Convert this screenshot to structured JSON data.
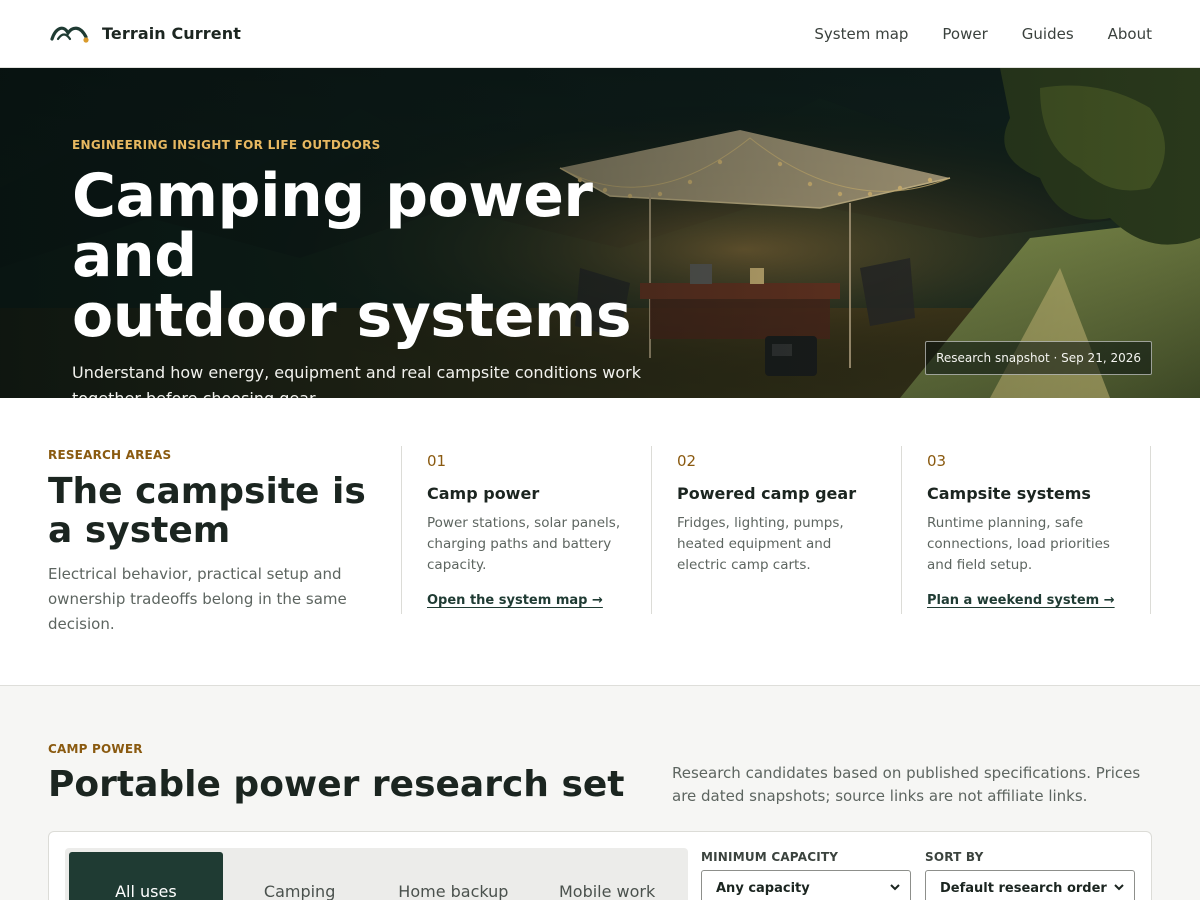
{
  "header": {
    "brand_name": "Terrain Current",
    "nav": [
      {
        "label": "System map"
      },
      {
        "label": "Power"
      },
      {
        "label": "Guides"
      },
      {
        "label": "About"
      }
    ]
  },
  "hero": {
    "eyebrow": "ENGINEERING INSIGHT FOR LIFE OUTDOORS",
    "title_line1": "Camping power and",
    "title_line2": "outdoor systems",
    "subtitle": "Understand how energy, equipment and real campsite conditions work together before choosing gear.",
    "snapshot": "Research snapshot · Sep 21, 2026"
  },
  "research": {
    "eyebrow": "RESEARCH AREAS",
    "title": "The campsite is a system",
    "description": "Electrical behavior, practical setup and ownership tradeoffs belong in the same decision.",
    "areas": [
      {
        "num": "01",
        "title": "Camp power",
        "desc": "Power stations, solar panels, charging paths and battery capacity.",
        "link": "Open the system map →"
      },
      {
        "num": "02",
        "title": "Powered camp gear",
        "desc": "Fridges, lighting, pumps, heated equipment and electric camp carts.",
        "link": ""
      },
      {
        "num": "03",
        "title": "Campsite systems",
        "desc": "Runtime planning, safe connections, load priorities and field setup.",
        "link": "Plan a weekend system →"
      }
    ]
  },
  "camp_power": {
    "eyebrow": "CAMP POWER",
    "title": "Portable power research set",
    "note": "Research candidates based on published specifications. Prices are dated snapshots; source links are not affiliate links.",
    "tabs": [
      {
        "label": "All uses"
      },
      {
        "label": "Camping"
      },
      {
        "label": "Home backup"
      },
      {
        "label": "Mobile work"
      }
    ],
    "min_capacity": {
      "label": "MINIMUM CAPACITY",
      "value": "Any capacity"
    },
    "sort_by": {
      "label": "SORT BY",
      "value": "Default research order"
    }
  },
  "colors": {
    "accent_dark_green": "#1f3b33",
    "eyebrow_amber": "#8a5a10",
    "hero_eyebrow_gold": "#e7b861"
  }
}
